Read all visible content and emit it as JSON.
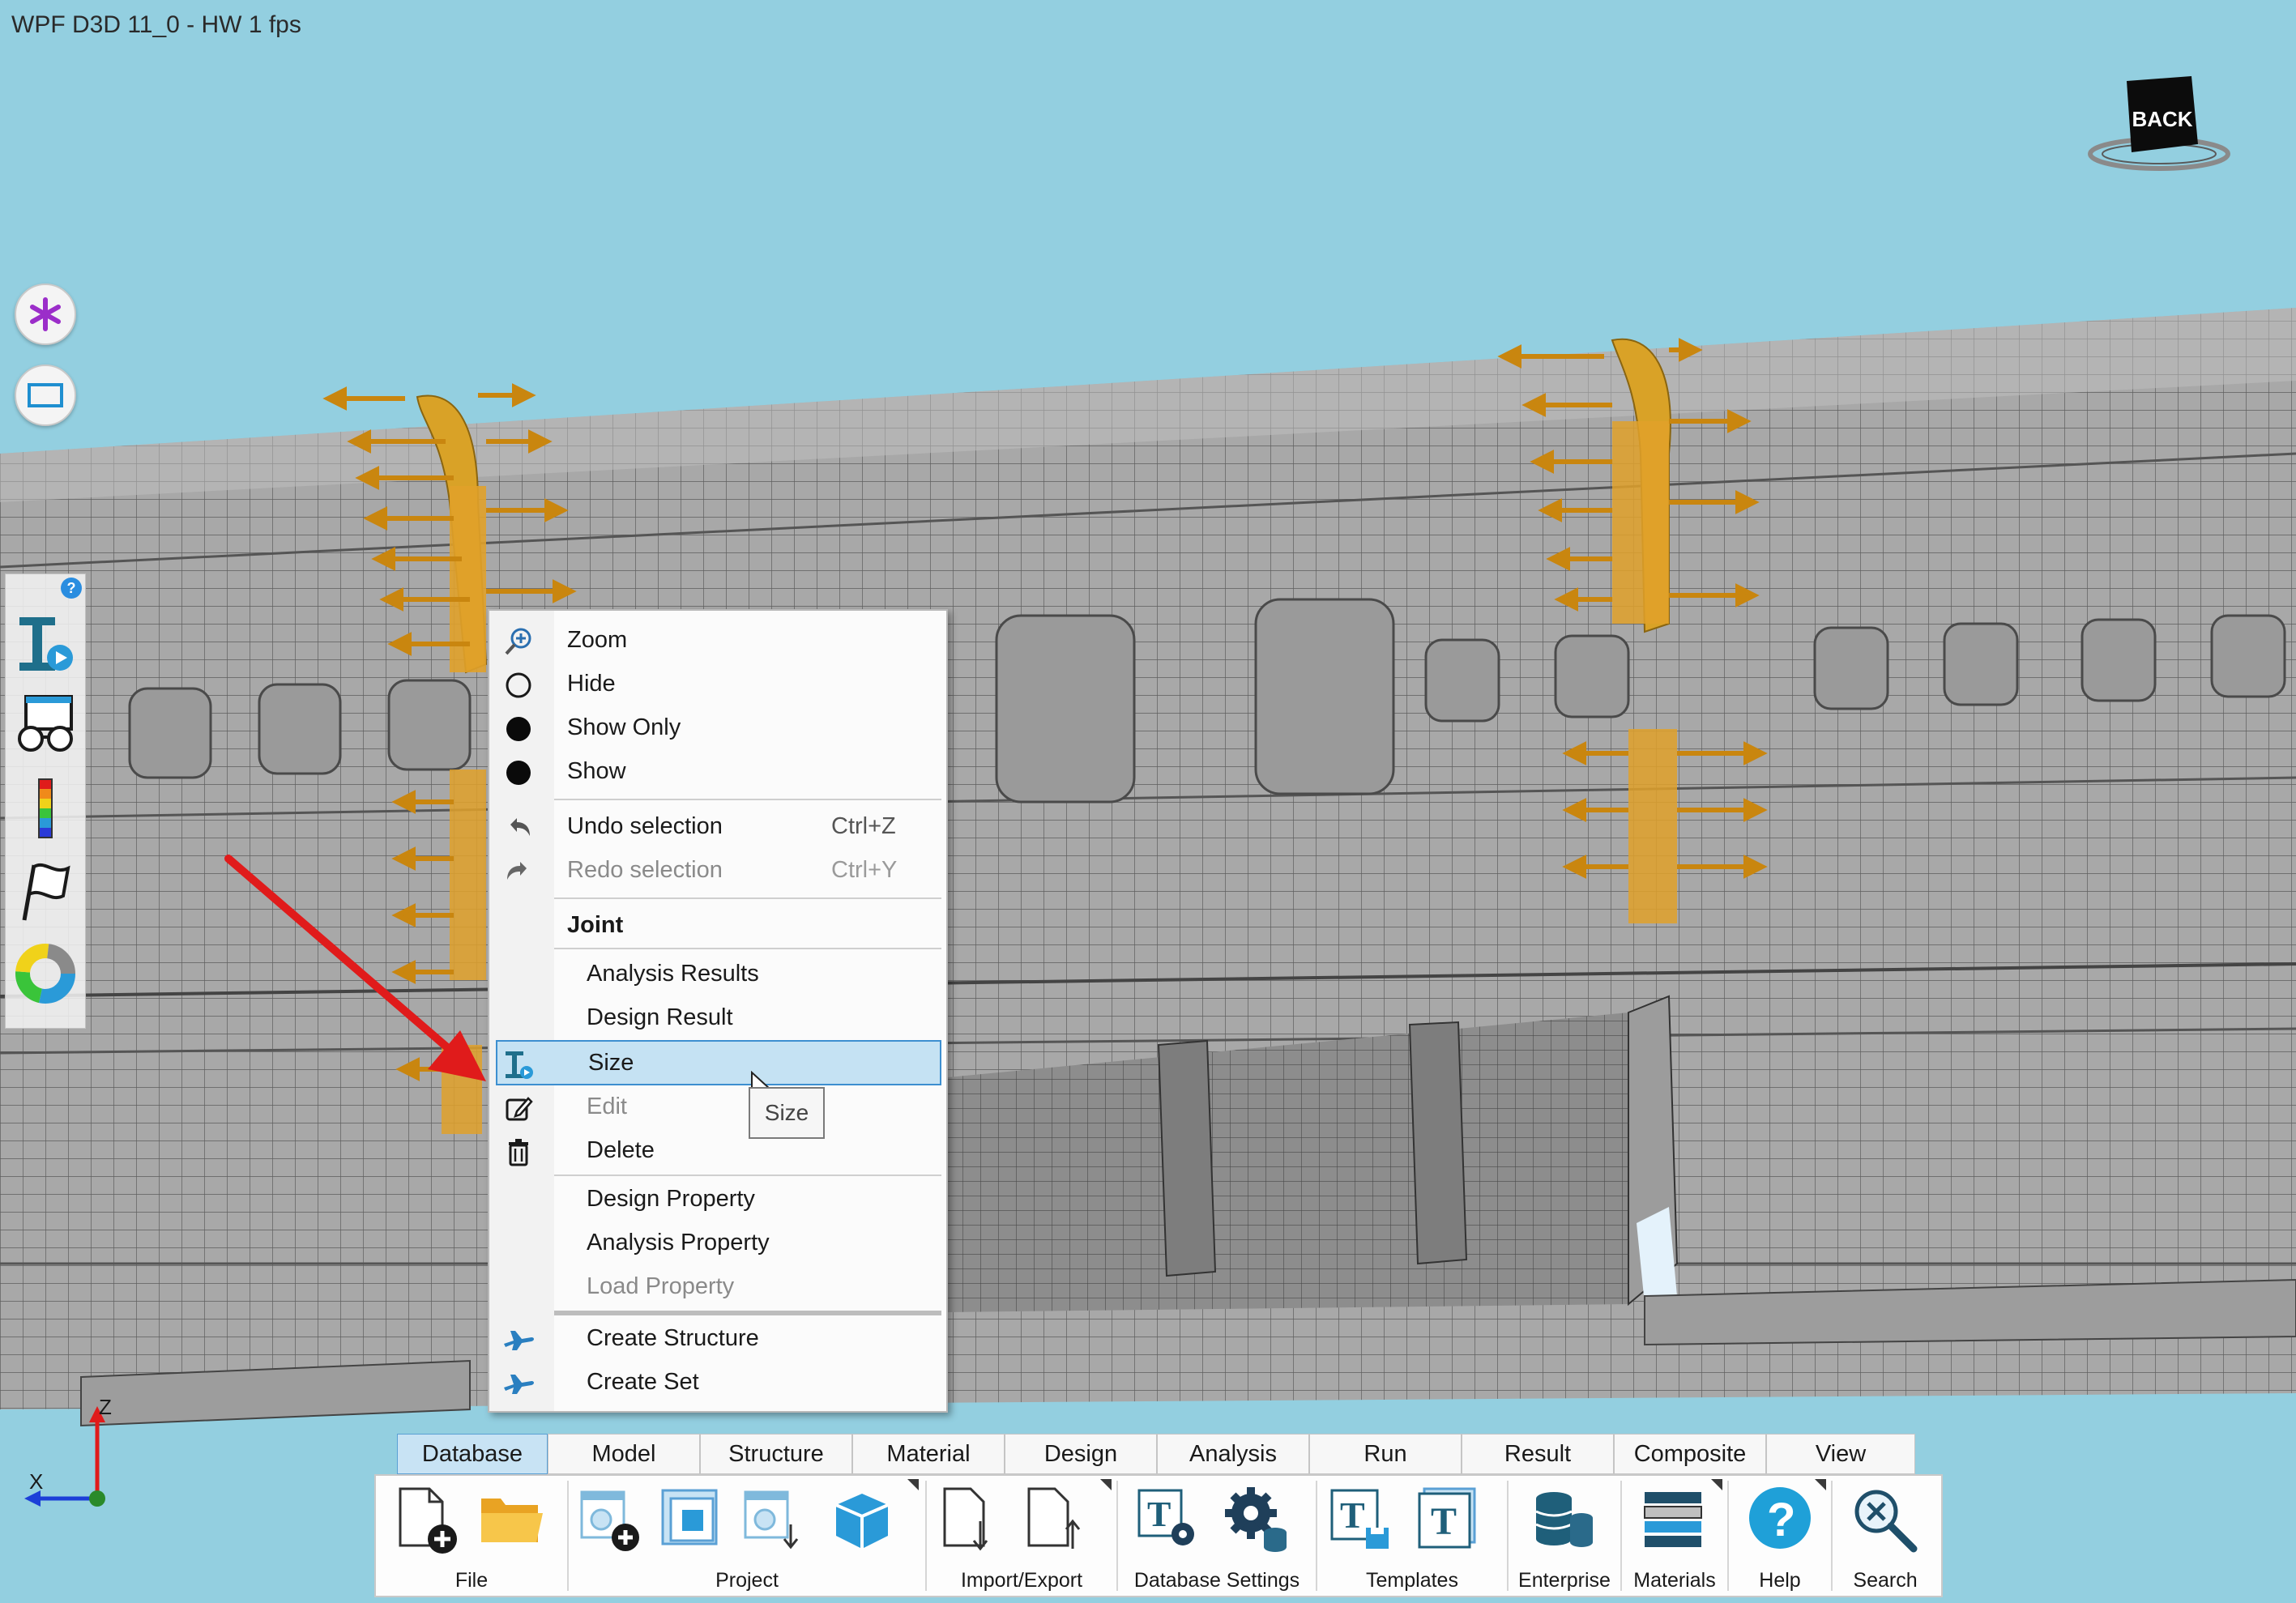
{
  "window": {
    "title": "WPF D3D 11_0 - HW  1 fps"
  },
  "viewcube": {
    "label": "BACK"
  },
  "left_buttons": [
    {
      "icon": "asterisk-icon",
      "color": "#9b2ec9"
    },
    {
      "icon": "rectangle-select-icon",
      "color": "#1f8fd0"
    }
  ],
  "tool_palette": {
    "help_label": "?",
    "items": [
      "size-tool-icon",
      "viewer-glasses-icon",
      "color-scale-icon",
      "flag-icon",
      "donut-chart-icon"
    ]
  },
  "axis": {
    "x": "X",
    "z": "Z"
  },
  "context_menu": {
    "items": {
      "zoom": "Zoom",
      "hide": "Hide",
      "show_only": "Show Only",
      "show": "Show",
      "undo": {
        "label": "Undo selection",
        "shortcut": "Ctrl+Z"
      },
      "redo": {
        "label": "Redo selection",
        "shortcut": "Ctrl+Y"
      },
      "joint": "Joint",
      "analysis_results": "Analysis Results",
      "design_result": "Design Result",
      "size": "Size",
      "edit": "Edit",
      "delete": "Delete",
      "design_property": "Design Property",
      "analysis_property": "Analysis Property",
      "load_property": "Load Property",
      "create_structure": "Create Structure",
      "create_set": "Create Set"
    },
    "highlighted": "Size",
    "tooltip": "Size"
  },
  "ribbon": {
    "tabs": [
      "Database",
      "Model",
      "Structure",
      "Material",
      "Design",
      "Analysis",
      "Run",
      "Result",
      "Composite",
      "View"
    ],
    "active_tab": "Database",
    "groups": {
      "file": "File",
      "project": "Project",
      "import_export": "Import/Export",
      "database_settings": "Database Settings",
      "templates": "Templates",
      "enterprise": "Enterprise",
      "materials": "Materials",
      "help": "Help",
      "search": "Search"
    }
  },
  "colors": {
    "sky": "#93cfe0",
    "mesh": "#a9a9a9",
    "load_arrows": "#e0a12a",
    "menu_highlight": "#c5e2f3",
    "annotation_arrow": "#e01b1b"
  }
}
